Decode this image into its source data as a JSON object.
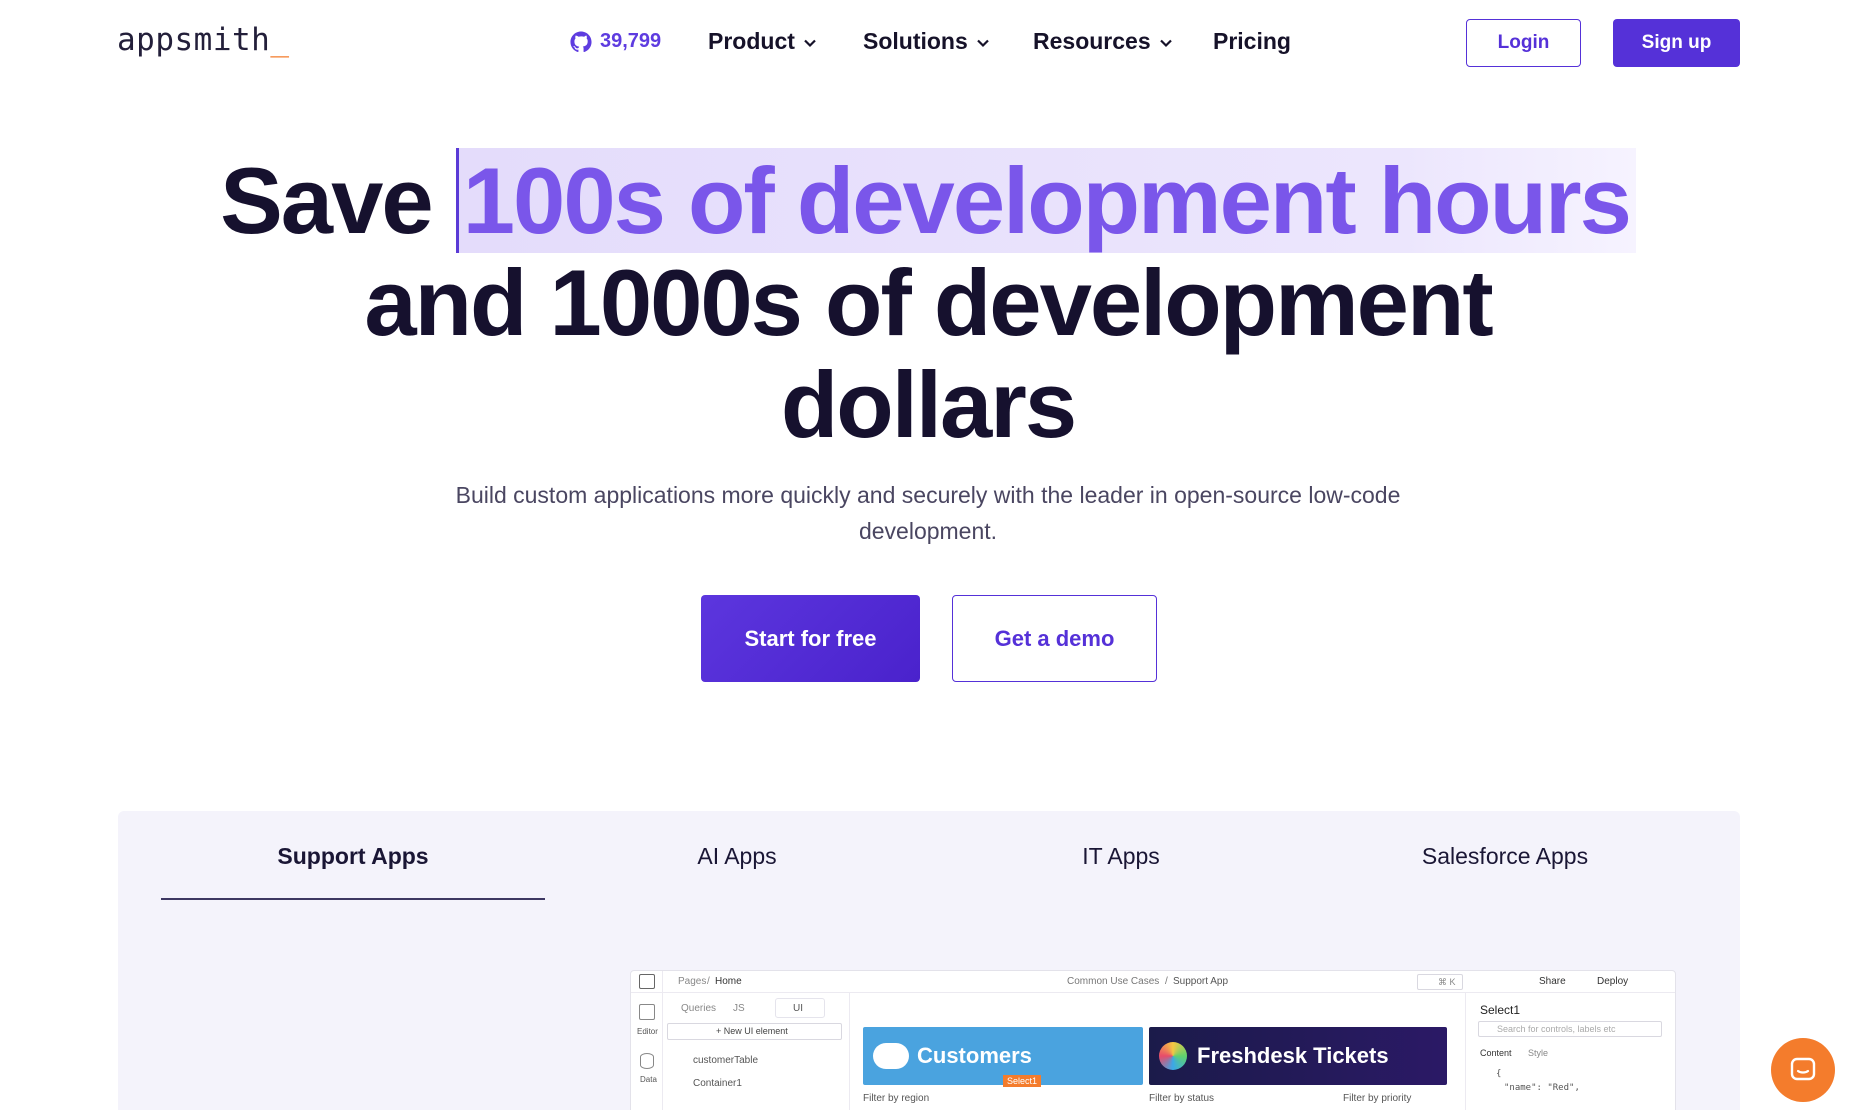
{
  "nav": {
    "logo": "appsmith",
    "logo_suffix": "_",
    "github_stars": "39,799",
    "menu": [
      {
        "label": "Product"
      },
      {
        "label": "Solutions"
      },
      {
        "label": "Resources"
      },
      {
        "label": "Pricing"
      }
    ],
    "login_label": "Login",
    "signup_label": "Sign up"
  },
  "hero": {
    "line1_start": "Save",
    "line1_highlight": "100s of development hours",
    "line2": "and 1000s of development",
    "line3": "dollars",
    "subtitle": "Build custom applications more quickly and securely with the leader in open-source low-code development.",
    "cta_primary": "Start for free",
    "cta_secondary": "Get a demo"
  },
  "tabs": [
    {
      "label": "Support Apps",
      "active": true
    },
    {
      "label": "AI Apps",
      "active": false
    },
    {
      "label": "IT Apps",
      "active": false
    },
    {
      "label": "Salesforce Apps",
      "active": false
    }
  ],
  "app_preview": {
    "breadcrumb_pages": "Pages",
    "breadcrumb_home": "Home",
    "breadcrumb_center_1": "Common Use Cases",
    "breadcrumb_center_2": "Support App",
    "search_shortcut": "⌘ K",
    "share_label": "Share",
    "deploy_label": "Deploy",
    "left_editor": "Editor",
    "left_data": "Data",
    "side_tabs": [
      "Queries",
      "JS",
      "UI"
    ],
    "new_ui_element": "+ New UI element",
    "tree": [
      "customerTable",
      "Container1"
    ],
    "card_customers": "Customers",
    "card_freshdesk": "Freshdesk Tickets",
    "select_tag": "Select1",
    "filter_region": "Filter by region",
    "filter_status": "Filter by status",
    "filter_priority": "Filter by priority",
    "right_title": "Select1",
    "right_search_placeholder": "Search for controls, labels etc",
    "right_tabs": [
      "Content",
      "Style"
    ],
    "code_line1": "{",
    "code_line2": "\"name\": \"Red\","
  },
  "colors": {
    "brand_purple": "#5531d8",
    "highlight_text": "#7a56ea",
    "logo_accent": "#f47c2c",
    "chat_bubble": "#f47c2c"
  }
}
